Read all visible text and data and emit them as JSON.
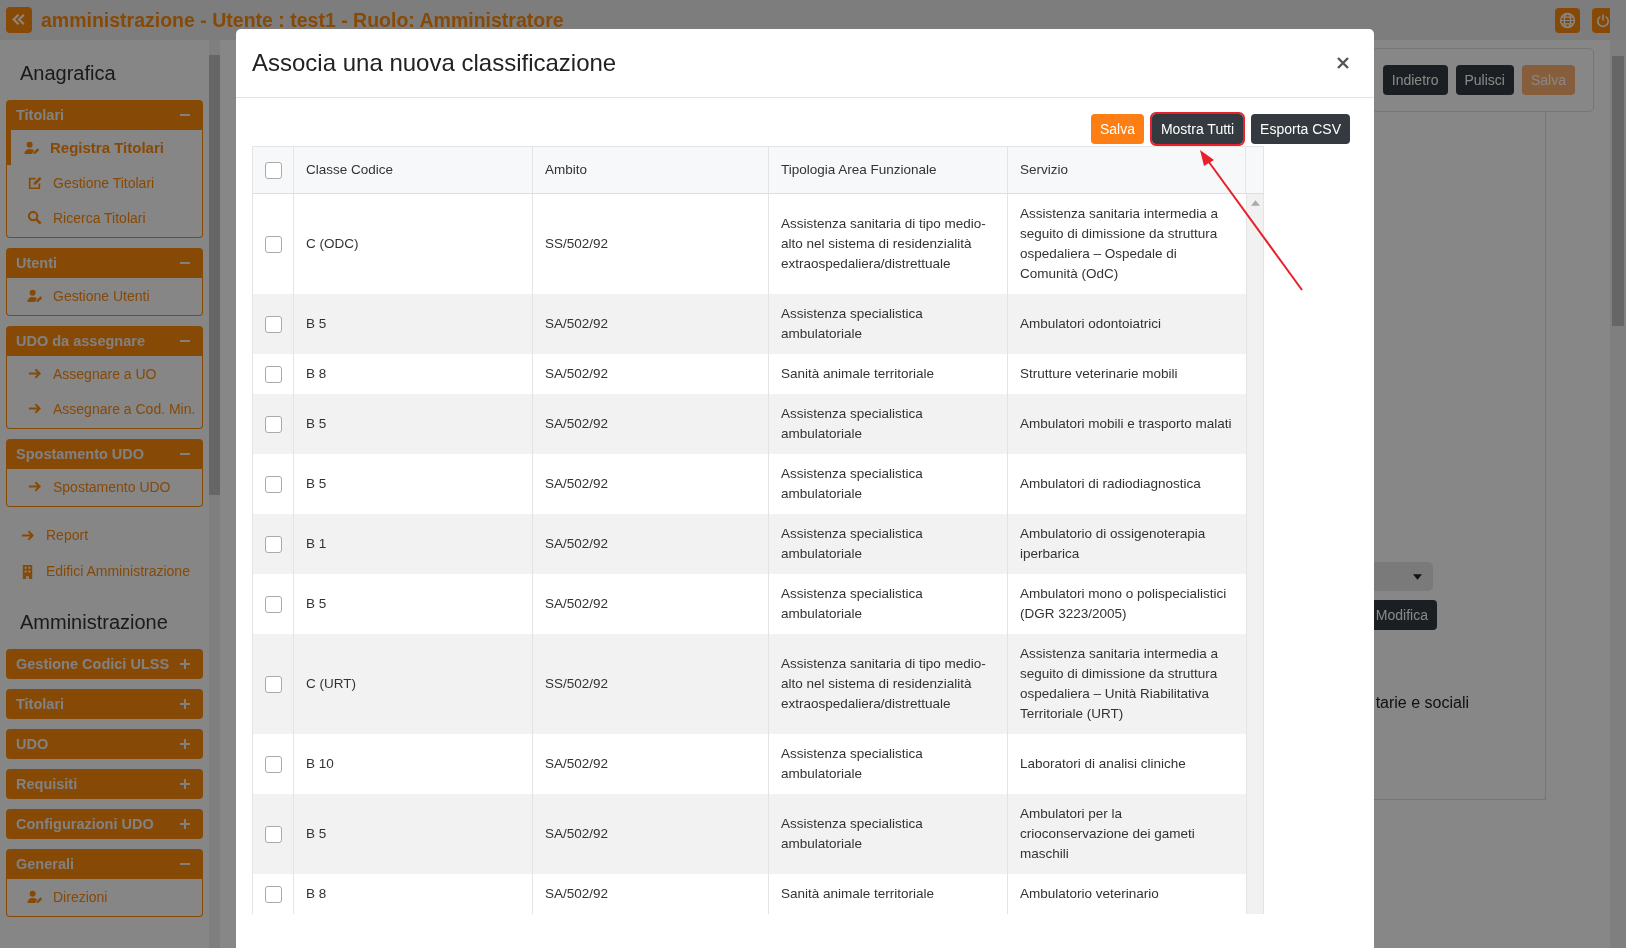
{
  "header": {
    "title": "amministrazione - Utente : test1 - Ruolo: Amministratore"
  },
  "sidebar": {
    "sections": [
      {
        "title": "Anagrafica",
        "entries": [
          {
            "kind": "group",
            "label": "Titolari",
            "expanded": true,
            "items": [
              {
                "label": "Registra Titolari",
                "selected": true
              },
              {
                "label": "Gestione Titolari",
                "selected": false
              },
              {
                "label": "Ricerca Titolari",
                "selected": false
              }
            ]
          },
          {
            "kind": "group",
            "label": "Utenti",
            "expanded": true,
            "items": [
              {
                "label": "Gestione Utenti",
                "selected": false
              }
            ]
          },
          {
            "kind": "group",
            "label": "UDO da assegnare",
            "expanded": true,
            "items": [
              {
                "label": "Assegnare a UO",
                "selected": false
              },
              {
                "label": "Assegnare a Cod. Min.",
                "selected": false
              }
            ]
          },
          {
            "kind": "group",
            "label": "Spostamento UDO",
            "expanded": true,
            "items": [
              {
                "label": "Spostamento UDO",
                "selected": false
              }
            ]
          },
          {
            "kind": "link",
            "label": "Report"
          },
          {
            "kind": "link",
            "label": "Edifici Amministrazione"
          }
        ]
      },
      {
        "title": "Amministrazione",
        "entries": [
          {
            "kind": "group",
            "label": "Gestione Codici ULSS",
            "expanded": false
          },
          {
            "kind": "group",
            "label": "Titolari",
            "expanded": false
          },
          {
            "kind": "group",
            "label": "UDO",
            "expanded": false
          },
          {
            "kind": "group",
            "label": "Requisiti",
            "expanded": false
          },
          {
            "kind": "group",
            "label": "Configurazioni UDO",
            "expanded": false
          },
          {
            "kind": "group",
            "label": "Generali",
            "expanded": true,
            "items": [
              {
                "label": "Direzioni",
                "selected": false
              }
            ]
          }
        ]
      }
    ]
  },
  "page": {
    "toolbar": [
      {
        "label": "Indietro",
        "kind": "dark"
      },
      {
        "label": "Pulisci",
        "kind": "dark"
      },
      {
        "label": "Salva",
        "kind": "primary"
      }
    ],
    "edit_button": "Modifica",
    "partial_text": "tarie e sociali"
  },
  "modal": {
    "title": "Associa una nuova classificazione",
    "buttons": [
      {
        "label": "Salva",
        "kind": "primary",
        "highlighted": false
      },
      {
        "label": "Mostra Tutti",
        "kind": "dark",
        "highlighted": true
      },
      {
        "label": "Esporta CSV",
        "kind": "dark",
        "highlighted": false
      }
    ],
    "table": {
      "all_checked": false,
      "columns": [
        "Classe Codice",
        "Ambito",
        "Tipologia Area Funzionale",
        "Servizio"
      ],
      "rows": [
        {
          "checked": false,
          "cells": [
            "C (ODC)",
            "SS/502/92",
            "Assistenza sanitaria di tipo medio-alto nel sistema di residenzialità extraospedaliera/distrettuale",
            "Assistenza sanitaria intermedia a seguito di dimissione da struttura ospedaliera – Ospedale di Comunità (OdC)"
          ]
        },
        {
          "checked": false,
          "cells": [
            "B 5",
            "SA/502/92",
            "Assistenza specialistica ambulatoriale",
            "Ambulatori odontoiatrici"
          ]
        },
        {
          "checked": false,
          "cells": [
            "B 8",
            "SA/502/92",
            "Sanità animale territoriale",
            "Strutture veterinarie mobili"
          ]
        },
        {
          "checked": false,
          "cells": [
            "B 5",
            "SA/502/92",
            "Assistenza specialistica ambulatoriale",
            "Ambulatori mobili e trasporto malati"
          ]
        },
        {
          "checked": false,
          "cells": [
            "B 5",
            "SA/502/92",
            "Assistenza specialistica ambulatoriale",
            "Ambulatori di radiodiagnostica"
          ]
        },
        {
          "checked": false,
          "cells": [
            "B 1",
            "SA/502/92",
            "Assistenza specialistica ambulatoriale",
            "Ambulatorio di ossigenoterapia iperbarica"
          ]
        },
        {
          "checked": false,
          "cells": [
            "B 5",
            "SA/502/92",
            "Assistenza specialistica ambulatoriale",
            "Ambulatori mono o polispecialistici (DGR 3223/2005)"
          ]
        },
        {
          "checked": false,
          "cells": [
            "C (URT)",
            "SS/502/92",
            "Assistenza sanitaria di tipo medio-alto nel sistema di residenzialità extraospedaliera/distrettuale",
            "Assistenza sanitaria intermedia a seguito di dimissione da struttura ospedaliera – Unità Riabilitativa Territoriale (URT)"
          ]
        },
        {
          "checked": false,
          "cells": [
            "B 10",
            "SA/502/92",
            "Assistenza specialistica ambulatoriale",
            "Laboratori di analisi cliniche"
          ]
        },
        {
          "checked": false,
          "cells": [
            "B 5",
            "SA/502/92",
            "Assistenza specialistica ambulatoriale",
            "Ambulatori per la crioconservazione dei gameti maschili"
          ]
        },
        {
          "checked": false,
          "cells": [
            "B 8",
            "SA/502/92",
            "Sanità animale territoriale",
            "Ambulatorio veterinario"
          ]
        }
      ]
    }
  }
}
